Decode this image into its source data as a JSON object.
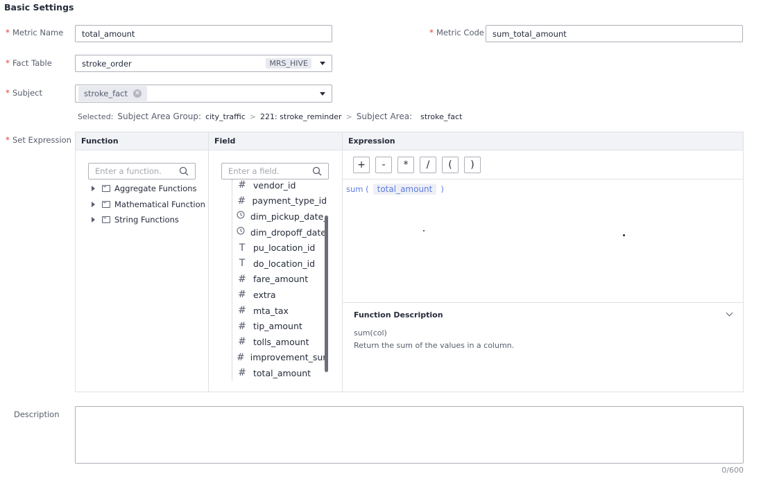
{
  "section_title": "Basic Settings",
  "fields": {
    "metric_name": {
      "label": "Metric Name",
      "value": "total_amount"
    },
    "metric_code": {
      "label": "Metric Code",
      "value": "sum_total_amount"
    },
    "fact_table": {
      "label": "Fact Table",
      "value": "stroke_order",
      "tag": "MRS_HIVE"
    },
    "subject": {
      "label": "Subject",
      "chip": "stroke_fact"
    },
    "set_expression": {
      "label": "Set Expression"
    },
    "description": {
      "label": "Description",
      "counter": "0/600"
    }
  },
  "selected_path": {
    "selected_label": "Selected:",
    "group_label": "Subject Area Group:",
    "group_value": "city_traffic",
    "sep1": ">",
    "reminder_value": "221: stroke_reminder",
    "sep2": ">",
    "area_label": "Subject Area:",
    "area_value": "stroke_fact"
  },
  "expression_editor": {
    "columns": {
      "function": "Function",
      "field": "Field",
      "expression": "Expression"
    },
    "function_search_placeholder": "Enter a function.",
    "field_search_placeholder": "Enter a field.",
    "function_tree": [
      {
        "label": "Aggregate Functions"
      },
      {
        "label": "Mathematical Function"
      },
      {
        "label": "String Functions"
      }
    ],
    "field_list": [
      {
        "icon": "#",
        "name": "vendor_id"
      },
      {
        "icon": "#",
        "name": "payment_type_id"
      },
      {
        "icon": "clock",
        "name": "dim_pickup_date_k"
      },
      {
        "icon": "clock",
        "name": "dim_dropoff_date_"
      },
      {
        "icon": "T",
        "name": "pu_location_id"
      },
      {
        "icon": "T",
        "name": "do_location_id"
      },
      {
        "icon": "#",
        "name": "fare_amount"
      },
      {
        "icon": "#",
        "name": "extra"
      },
      {
        "icon": "#",
        "name": "mta_tax"
      },
      {
        "icon": "#",
        "name": "tip_amount"
      },
      {
        "icon": "#",
        "name": "tolls_amount"
      },
      {
        "icon": "#",
        "name": "improvement_surc"
      },
      {
        "icon": "#",
        "name": "total_amount"
      }
    ],
    "operators": [
      "+",
      "-",
      "*",
      "/",
      "(",
      ")"
    ],
    "expression": {
      "func": "sum (",
      "field": "total_amount",
      "close": ")"
    },
    "function_description": {
      "title": "Function Description",
      "signature": "sum(col)",
      "text": "Return the sum of the values in a column."
    }
  }
}
